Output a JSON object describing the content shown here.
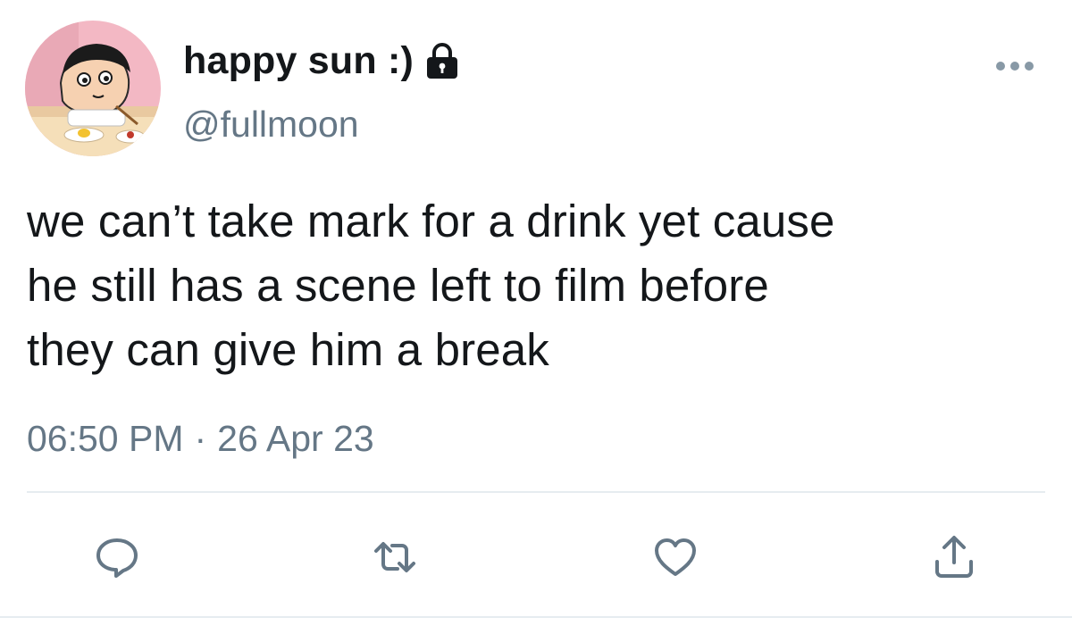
{
  "user": {
    "display_name": "happy sun :)",
    "handle": "@fullmoon",
    "protected_icon": "lock-icon",
    "avatar_icon": "cartoon-avatar"
  },
  "tweet": {
    "lines": [
      "we can’t take mark for a drink yet cause",
      "he still has a scene left to film before",
      "they can give him a break"
    ],
    "time": "06:50 PM",
    "separator": "·",
    "date": "26 Apr 23"
  },
  "actions": {
    "more": "more-options-icon",
    "reply": "reply-icon",
    "retweet": "retweet-icon",
    "like": "heart-icon",
    "share": "share-icon"
  },
  "colors": {
    "text": "#14171a",
    "secondary": "#657786",
    "divider": "#e6ecf0",
    "background": "#ffffff"
  }
}
